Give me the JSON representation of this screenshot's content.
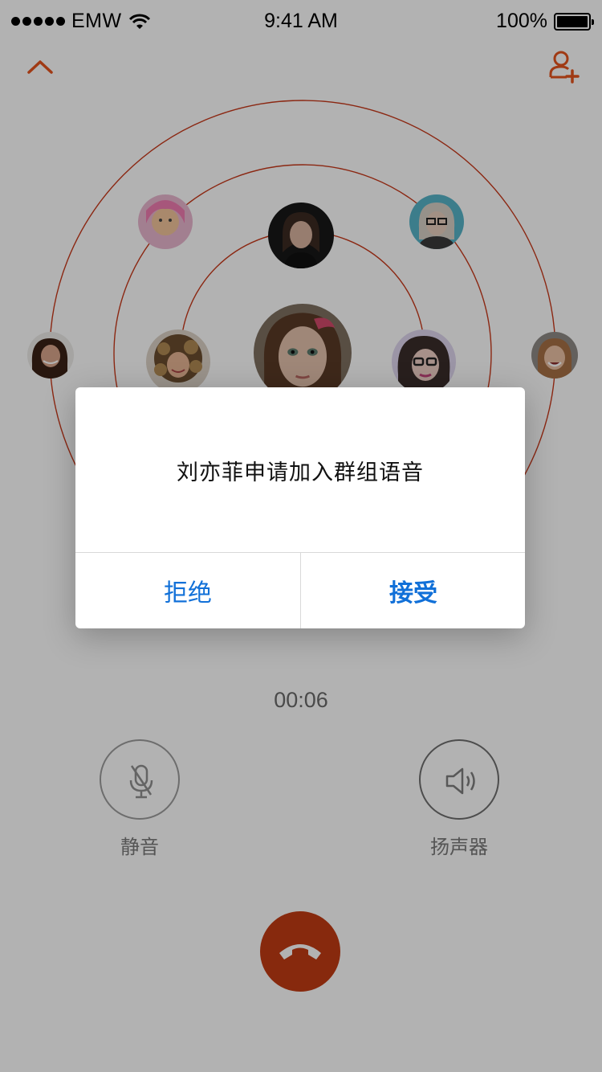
{
  "status_bar": {
    "carrier": "EMW",
    "time": "9:41 AM",
    "battery": "100%",
    "signal_icon": "signal-dots-icon",
    "wifi_icon": "wifi-icon",
    "battery_icon": "battery-icon"
  },
  "top_bar": {
    "collapse_icon": "chevron-up-icon",
    "add_member_icon": "add-user-icon",
    "accent_color": "#e5531d"
  },
  "participants": [
    {
      "name": "participant-1",
      "avatar": "avatar-photo"
    },
    {
      "name": "participant-2",
      "avatar": "avatar-photo"
    },
    {
      "name": "participant-3",
      "avatar": "avatar-photo"
    },
    {
      "name": "participant-4",
      "avatar": "avatar-photo"
    },
    {
      "name": "participant-5",
      "avatar": "avatar-photo"
    },
    {
      "name": "participant-6",
      "avatar": "avatar-photo"
    },
    {
      "name": "participant-7",
      "avatar": "avatar-photo"
    },
    {
      "name": "participant-8",
      "avatar": "avatar-photo"
    }
  ],
  "dialog": {
    "message": "刘亦菲申请加入群组语音",
    "reject_label": "拒绝",
    "accept_label": "接受",
    "button_color": "#1170d8"
  },
  "call": {
    "duration": "00:06",
    "mute_label": "静音",
    "speaker_label": "扬声器",
    "mute_icon": "microphone-off-icon",
    "speaker_icon": "speaker-icon",
    "hangup_icon": "phone-hangup-icon",
    "hangup_color": "#c23b14"
  }
}
